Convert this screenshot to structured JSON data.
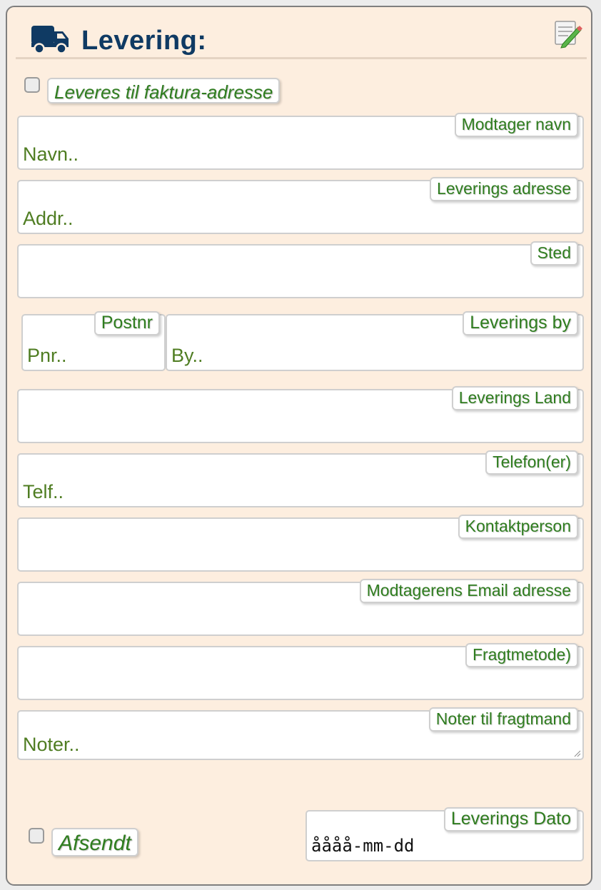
{
  "header": {
    "title": "Levering:",
    "truck_icon": "truck-icon",
    "edit_icon": "edit-icon"
  },
  "deliver_to_invoice": {
    "label": "Leveres til faktura-adresse",
    "checked": false
  },
  "fields": {
    "recipient_name": {
      "label": "Modtager navn",
      "placeholder": "Navn.."
    },
    "delivery_address": {
      "label": "Leverings adresse",
      "placeholder": "Addr.."
    },
    "place": {
      "label": "Sted",
      "placeholder": ""
    },
    "postal_code": {
      "label": "Postnr",
      "placeholder": "Pnr.."
    },
    "city": {
      "label": "Leverings by",
      "placeholder": "By.."
    },
    "country": {
      "label": "Leverings Land",
      "placeholder": ""
    },
    "phone": {
      "label": "Telefon(er)",
      "placeholder": "Telf.."
    },
    "contact_person": {
      "label": "Kontaktperson",
      "placeholder": ""
    },
    "email": {
      "label": "Modtagerens Email adresse",
      "placeholder": ""
    },
    "freight_method": {
      "label": "Fragtmetode)",
      "placeholder": ""
    },
    "notes": {
      "label": "Noter til fragtmand",
      "placeholder": "Noter.."
    },
    "delivery_date": {
      "label": "Leverings Dato",
      "value": "åååå-mm-dd"
    }
  },
  "sent": {
    "label": "Afsendt",
    "checked": false
  },
  "colors": {
    "panel_bg": "#fdeedf",
    "title": "#0f3a63",
    "label_green": "#2f7d1f",
    "placeholder_green": "#4f7d22"
  }
}
